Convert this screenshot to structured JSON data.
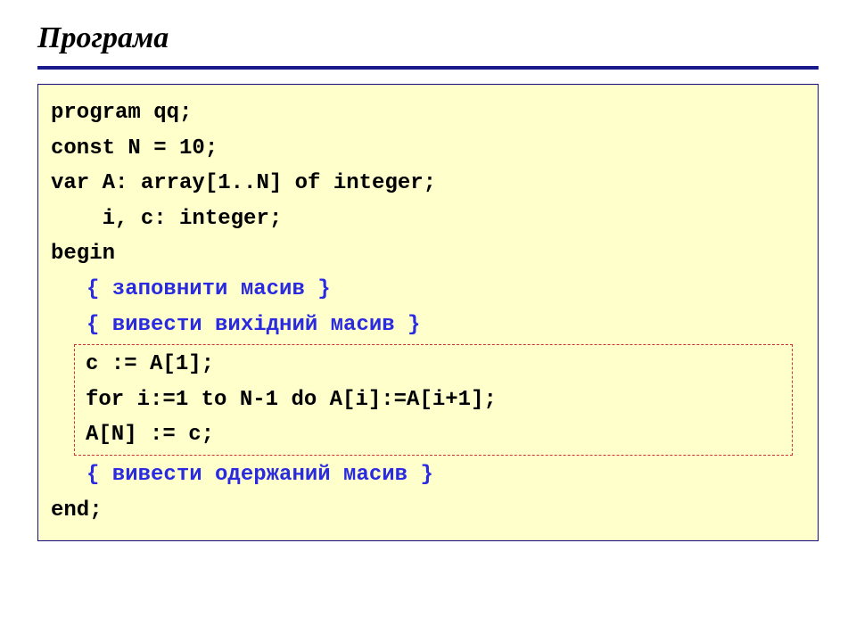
{
  "title": "Програма",
  "code": {
    "l1": "program qq;",
    "l2": "const N = 10;",
    "l3": "var A: array[1..N] of integer;",
    "l4": "    i, c: integer;",
    "l5": "begin",
    "c1": "{ заповнити масив }",
    "c2": "{ вивести вихідний масив }",
    "b1": "c := A[1];",
    "b2": "for i:=1 to N-1 do A[i]:=A[i+1];",
    "b3": "A[N] := c;",
    "c3": "{ вивести одержаний масив }",
    "l6": "end;"
  }
}
